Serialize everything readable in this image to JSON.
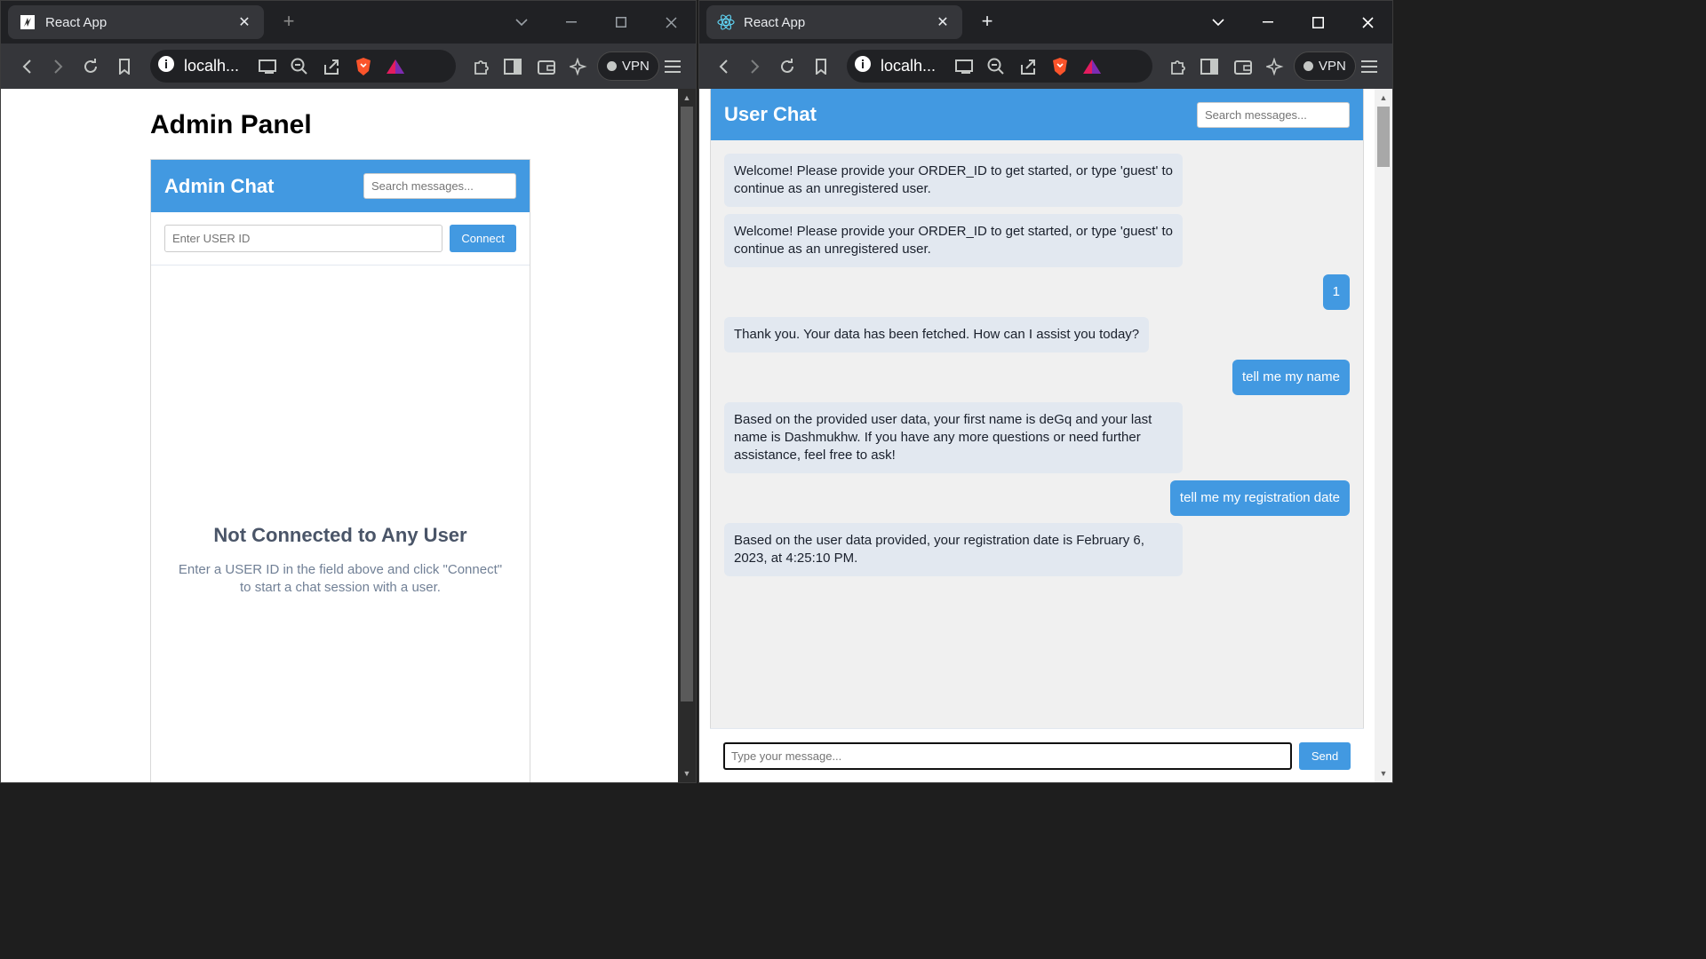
{
  "left_window": {
    "tab_title": "React App",
    "url": "localh...",
    "vpn_label": "VPN",
    "page": {
      "heading": "Admin Panel",
      "chat_title": "Admin Chat",
      "search_placeholder": "Search messages...",
      "userid_placeholder": "Enter USER ID",
      "connect_label": "Connect",
      "empty_title": "Not Connected to Any User",
      "empty_text": "Enter a USER ID in the field above and click \"Connect\" to start a chat session with a user."
    }
  },
  "right_window": {
    "tab_title": "React App",
    "url": "localh...",
    "vpn_label": "VPN",
    "page": {
      "chat_title": "User Chat",
      "search_placeholder": "Search messages...",
      "messages": [
        {
          "from": "bot",
          "text": "Welcome! Please provide your ORDER_ID to get started, or type 'guest' to continue as an unregistered user."
        },
        {
          "from": "bot",
          "text": "Welcome! Please provide your ORDER_ID to get started, or type 'guest' to continue as an unregistered user."
        },
        {
          "from": "user",
          "text": "1"
        },
        {
          "from": "bot",
          "text": "Thank you. Your data has been fetched. How can I assist you today?"
        },
        {
          "from": "user",
          "text": "tell me my name"
        },
        {
          "from": "bot",
          "text": "Based on the provided user data, your first name is deGq and your last name is Dashmukhw. If you have any more questions or need further assistance, feel free to ask!"
        },
        {
          "from": "user",
          "text": "tell me my registration date"
        },
        {
          "from": "bot",
          "text": "Based on the user data provided, your registration date is February 6, 2023, at 4:25:10 PM."
        }
      ],
      "message_placeholder": "Type your message...",
      "send_label": "Send"
    }
  },
  "colors": {
    "accent": "#4299e1",
    "bot_bubble": "#e2e8f0",
    "chat_bg": "#f0f0f0",
    "browser_dark": "#35363a"
  }
}
